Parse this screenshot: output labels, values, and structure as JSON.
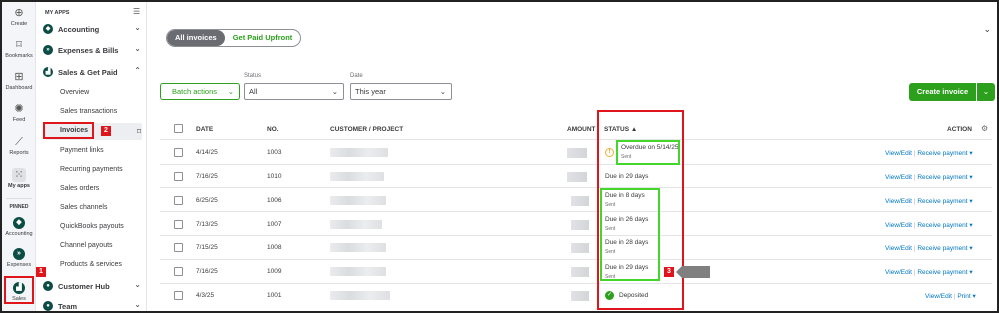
{
  "rail": {
    "items": [
      {
        "icon": "plus-circle",
        "label": "Create"
      },
      {
        "icon": "bookmark",
        "label": "Bookmarks"
      },
      {
        "icon": "grid",
        "label": "Dashboard"
      },
      {
        "icon": "feed",
        "label": "Feed"
      },
      {
        "icon": "chart",
        "label": "Reports"
      },
      {
        "icon": "apps",
        "label": "My apps"
      }
    ],
    "pinned_label": "PINNED",
    "pinned": [
      {
        "label": "Accounting"
      },
      {
        "label": "Expenses"
      },
      {
        "label": "Sales"
      }
    ]
  },
  "menu": {
    "header": "MY APPS",
    "categories": [
      {
        "label": "Accounting",
        "chevron": "down"
      },
      {
        "label": "Expenses & Bills",
        "chevron": "down"
      },
      {
        "label": "Sales & Get Paid",
        "chevron": "up"
      }
    ],
    "sales_items": [
      "Overview",
      "Sales transactions",
      "Invoices",
      "Payment links",
      "Recurring payments",
      "Sales orders",
      "Sales channels",
      "QuickBooks payouts",
      "Channel payouts",
      "Products & services"
    ],
    "bottom_categories": [
      {
        "label": "Customer Hub",
        "chevron": "down"
      },
      {
        "label": "Team",
        "chevron": "down"
      }
    ]
  },
  "tabs": {
    "active": "All invoices",
    "inactive": "Get Paid Upfront"
  },
  "filters": {
    "batch_label": "Batch actions",
    "status_label": "Status",
    "status_value": "All",
    "date_label": "Date",
    "date_value": "This year"
  },
  "create_button": "Create invoice",
  "table": {
    "headers": {
      "date": "DATE",
      "no": "NO.",
      "customer": "CUSTOMER / PROJECT",
      "amount": "AMOUNT",
      "status": "STATUS ▲",
      "action": "ACTION"
    },
    "rows": [
      {
        "date": "4/14/25",
        "no": "1003",
        "status": "Overdue on 5/14/25",
        "sub": "Sent",
        "action1": "View/Edit",
        "action2": "Receive payment"
      },
      {
        "date": "7/16/25",
        "no": "1010",
        "status": "Due in 29 days",
        "sub": "",
        "action1": "View/Edit",
        "action2": "Receive payment"
      },
      {
        "date": "6/25/25",
        "no": "1006",
        "status": "Due in 8 days",
        "sub": "Sent",
        "action1": "View/Edit",
        "action2": "Receive payment"
      },
      {
        "date": "7/13/25",
        "no": "1007",
        "status": "Due in 26 days",
        "sub": "Sent",
        "action1": "View/Edit",
        "action2": "Receive payment"
      },
      {
        "date": "7/15/25",
        "no": "1008",
        "status": "Due in 28 days",
        "sub": "Sent",
        "action1": "View/Edit",
        "action2": "Receive payment"
      },
      {
        "date": "7/16/25",
        "no": "1009",
        "status": "Due in 29 days",
        "sub": "Sent",
        "action1": "View/Edit",
        "action2": "Receive payment"
      },
      {
        "date": "4/3/25",
        "no": "1001",
        "status": "Deposited",
        "sub": "",
        "action1": "View/Edit",
        "action2": "Print"
      }
    ]
  },
  "annotations": {
    "badge1": "1",
    "badge2": "2",
    "badge3": "3"
  },
  "colors": {
    "brand_green": "#2ca01c",
    "annotation_red": "#e0151c",
    "annotation_green": "#44d62c",
    "link_blue": "#0077c5"
  }
}
